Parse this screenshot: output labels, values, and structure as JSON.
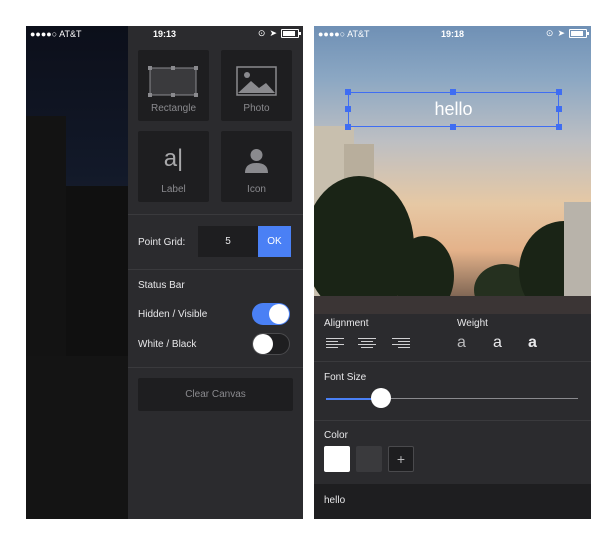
{
  "left_screen": {
    "status_bar": {
      "carrier": "●●●●○ AT&T",
      "time": "19:13"
    },
    "tiles": [
      {
        "label": "Rectangle",
        "icon": "rectangle-icon"
      },
      {
        "label": "Photo",
        "icon": "photo-icon"
      },
      {
        "label": "Label",
        "icon": "label-icon",
        "glyph": "a|"
      },
      {
        "label": "Icon",
        "icon": "person-icon"
      }
    ],
    "point_grid": {
      "label": "Point Grid:",
      "value": "5",
      "ok_label": "OK"
    },
    "status_bar_section": {
      "title": "Status Bar",
      "hidden_visible": {
        "label": "Hidden / Visible",
        "on": true
      },
      "white_black": {
        "label": "White / Black",
        "on": false
      }
    },
    "clear_canvas_label": "Clear Canvas"
  },
  "right_screen": {
    "status_bar": {
      "carrier": "●●●●○ AT&T",
      "time": "19:18"
    },
    "canvas_text": "hello",
    "alignment_label": "Alignment",
    "weight_label": "Weight",
    "weights": [
      {
        "glyph": "a",
        "style": "light"
      },
      {
        "glyph": "a",
        "style": "regular"
      },
      {
        "glyph": "a",
        "style": "bold"
      }
    ],
    "font_size_label": "Font Size",
    "font_size_fraction": 0.22,
    "color_label": "Color",
    "swatches": [
      "#ffffff",
      "#3a3a3d"
    ],
    "add_color_glyph": "+",
    "text_value": "hello",
    "accent_color": "#4a80f5"
  }
}
